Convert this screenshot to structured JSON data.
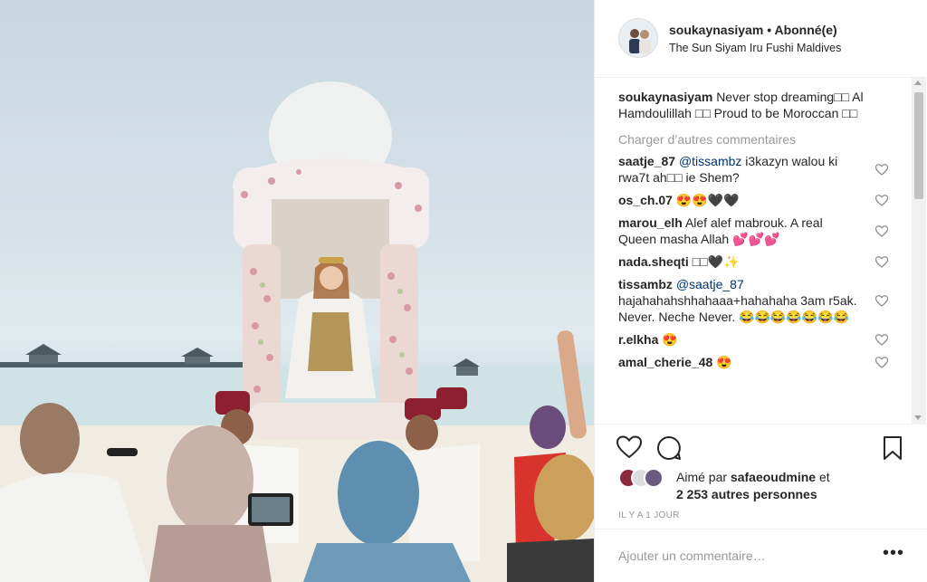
{
  "post": {
    "username": "soukaynasiyam",
    "separator": "•",
    "follow_state": "Abonné(e)",
    "location": "The Sun Siyam Iru Fushi Maldives",
    "photo_description_icon": "wedding-photo"
  },
  "caption": {
    "username": "soukaynasiyam",
    "text": "Never stop dreaming□□ Al Hamdoulillah □□ Proud to be Moroccan □□"
  },
  "load_more_label": "Charger d’autres commentaires",
  "comments": [
    {
      "username": "saatje_87",
      "mention": "@tissambz",
      "text": "i3kazyn walou ki rwa7t ah□□ ie Shem?"
    },
    {
      "username": "os_ch.07",
      "mention": "",
      "text": "😍😍🖤🖤"
    },
    {
      "username": "marou_elh",
      "mention": "",
      "text": "Alef alef mabrouk. A real Queen masha Allah 💕💕💕"
    },
    {
      "username": "nada.sheqti",
      "mention": "",
      "text": "□□🖤✨"
    },
    {
      "username": "tissambz",
      "mention": "@saatje_87",
      "text": "hajahahahshhahaaa+hahahaha 3am r5ak. Never. Neche Never. 😂😂😂😂😂😂😂"
    },
    {
      "username": "r.elkha",
      "mention": "",
      "text": "😍"
    },
    {
      "username": "amal_cherie_48",
      "mention": "",
      "text": "😍"
    }
  ],
  "likes": {
    "prefix": "Aimé par",
    "user": "safaeoudmine",
    "joiner": "et",
    "others": "2 253 autres personnes"
  },
  "timestamp": "Il y a 1 jour",
  "add_comment_placeholder": "Ajouter un commentaire…",
  "more_options": "•••",
  "colors": {
    "text": "#262626",
    "muted": "#999999",
    "mention": "#003569",
    "border": "#efefef"
  },
  "icons": [
    "heart-icon",
    "comment-icon",
    "bookmark-icon",
    "more-options-icon",
    "like-heart-icon"
  ]
}
